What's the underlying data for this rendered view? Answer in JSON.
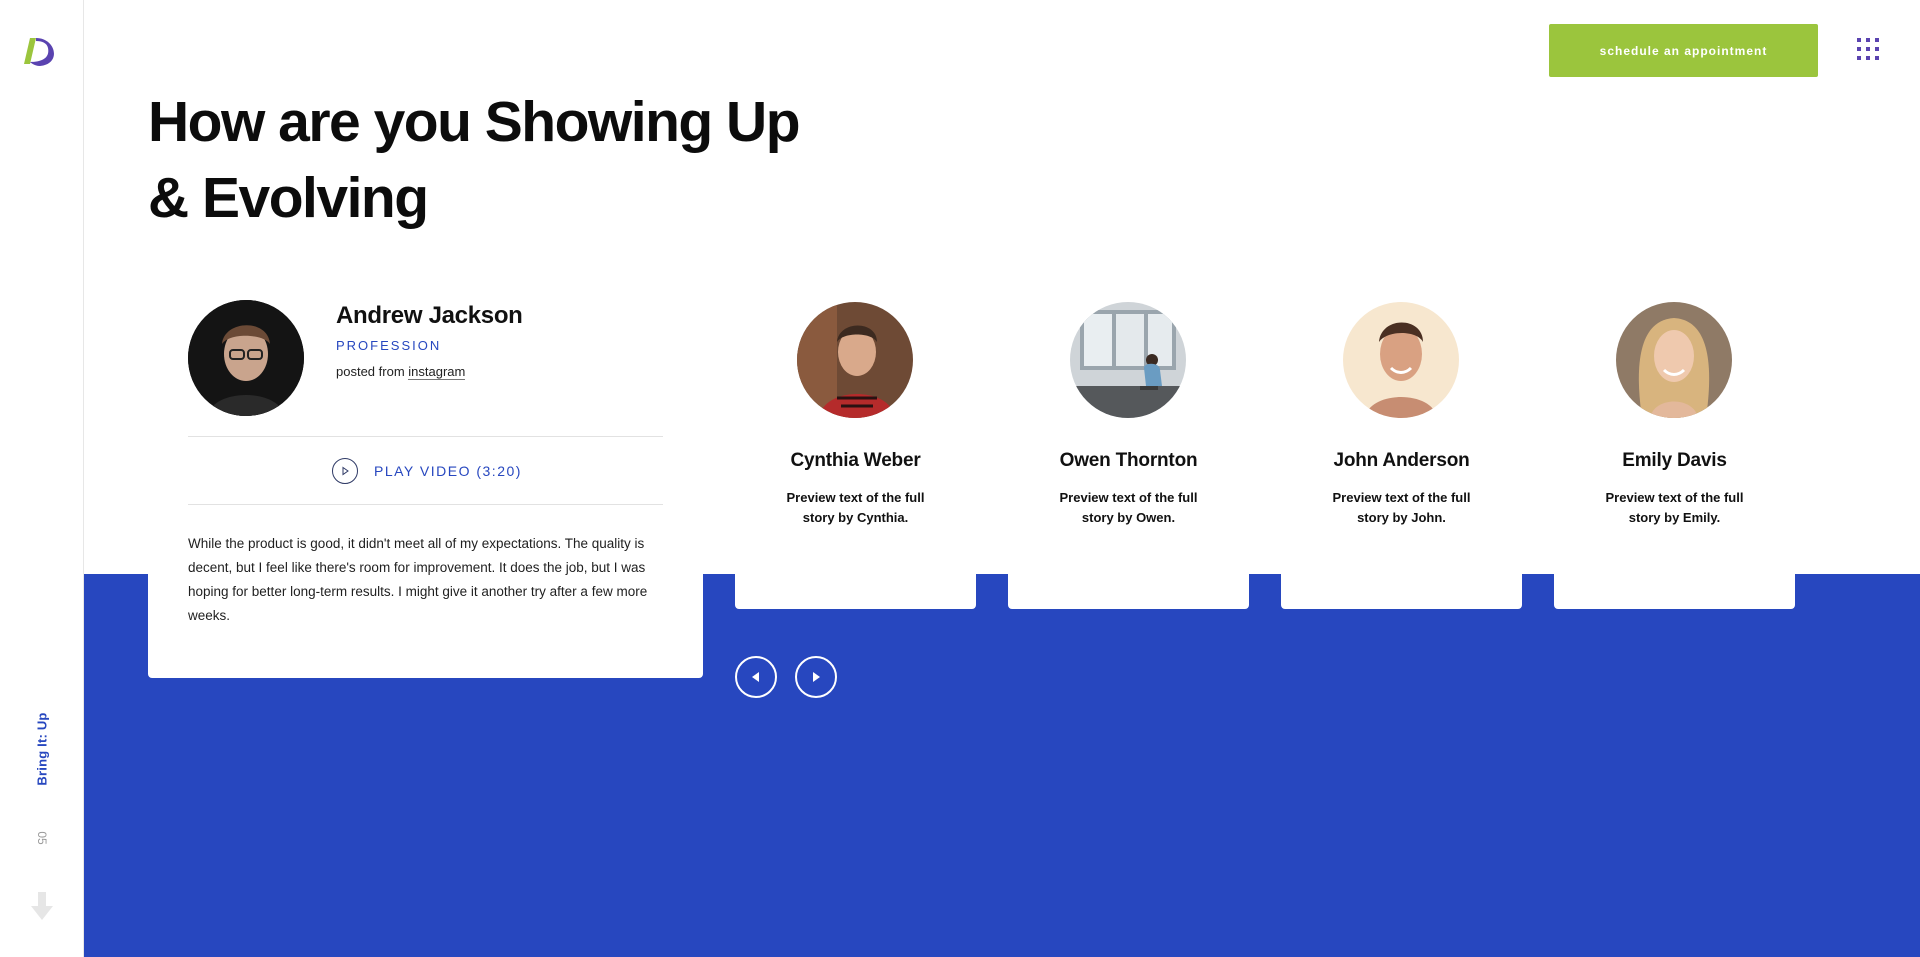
{
  "brand": {
    "logo_icon": "brand-logo-icon",
    "colors": {
      "accent_blue": "#2747bf",
      "cta_green": "#9bc53d",
      "logo_purple": "#5a43b0"
    }
  },
  "header": {
    "cta_label": "schedule an appointment",
    "menu_icon": "grid-menu-icon"
  },
  "rail": {
    "section_label": "Bring It: Up",
    "section_number": "05",
    "scroll_icon": "arrow-down-icon"
  },
  "section": {
    "title_line1": "How are you Showing Up",
    "title_line2": "& Evolving"
  },
  "featured": {
    "name": "Andrew Jackson",
    "profession": "PROFESSION",
    "posted_prefix": "posted from",
    "posted_source": "instagram",
    "play_label": "PLAY VIDEO (3:20)",
    "review": "While the product is good, it didn't meet all of my expectations. The quality is decent, but I feel like there's room for improvement. It does the job, but I was hoping for better long-term results. I might give it another try after a few more weeks."
  },
  "stories": [
    {
      "name": "Cynthia Weber",
      "preview": "Preview text of the full story by Cynthia."
    },
    {
      "name": "Owen Thornton",
      "preview": "Preview text of the full story by Owen."
    },
    {
      "name": "John Anderson",
      "preview": "Preview text of the full story by John."
    },
    {
      "name": "Emily Davis",
      "preview": "Preview text of the full story by Emily."
    }
  ],
  "carousel": {
    "prev_icon": "arrow-left-icon",
    "next_icon": "arrow-right-icon"
  }
}
